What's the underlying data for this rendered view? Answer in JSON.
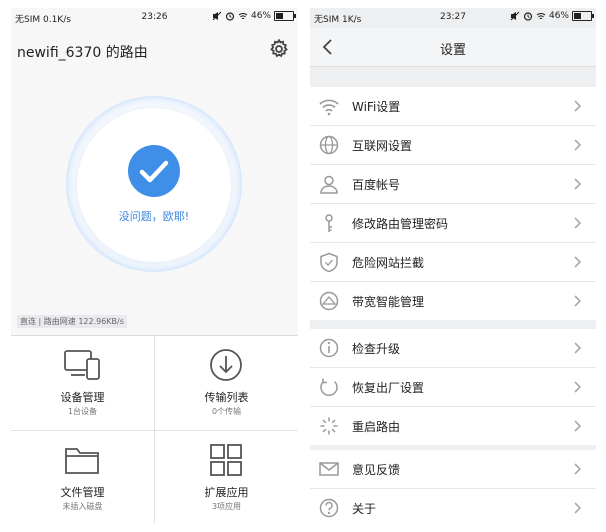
{
  "left_screen": {
    "statusbar": {
      "carrier": "无SIM 0.1K/s",
      "time": "23:26",
      "battery": "46%",
      "battery_level": 0.46
    },
    "router_name": "newifi_6370 的路由",
    "status_text": "没问题，欧耶!",
    "speed": "直连 | 路由网速 122.96KB/s",
    "tiles": [
      {
        "icon": "devices-icon",
        "title": "设备管理",
        "subtitle": "1台设备"
      },
      {
        "icon": "download-icon",
        "title": "传输列表",
        "subtitle": "0个传输"
      },
      {
        "icon": "folder-icon",
        "title": "文件管理",
        "subtitle": "未插入磁盘"
      },
      {
        "icon": "apps-grid-icon",
        "title": "扩展应用",
        "subtitle": "3项应用"
      }
    ]
  },
  "right_screen": {
    "statusbar": {
      "carrier": "无SIM 1K/s",
      "time": "23:27",
      "battery": "46%",
      "battery_level": 0.46
    },
    "title": "设置",
    "groups": [
      [
        {
          "icon": "wifi-icon",
          "label": "WiFi设置"
        },
        {
          "icon": "globe-icon",
          "label": "互联网设置"
        },
        {
          "icon": "user-icon",
          "label": "百度帐号"
        },
        {
          "icon": "key-icon",
          "label": "修改路由管理密码"
        },
        {
          "icon": "shield-icon",
          "label": "危险网站拦截"
        },
        {
          "icon": "bandwidth-icon",
          "label": "带宽智能管理"
        }
      ],
      [
        {
          "icon": "info-icon",
          "label": "检查升级"
        },
        {
          "icon": "restore-icon",
          "label": "恢复出厂设置"
        },
        {
          "icon": "restart-icon",
          "label": "重启路由"
        }
      ],
      [
        {
          "icon": "mail-icon",
          "label": "意见反馈"
        },
        {
          "icon": "help-icon",
          "label": "关于"
        }
      ]
    ]
  },
  "colors": {
    "accent": "#3f8ee8",
    "ring": "#5aa1ee",
    "icon_gray": "#999999"
  }
}
